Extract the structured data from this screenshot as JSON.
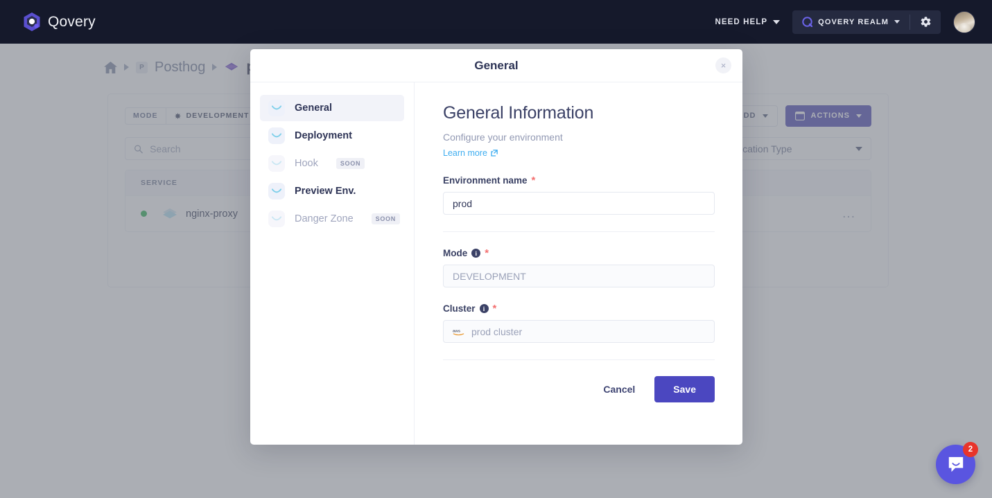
{
  "navbar": {
    "brand": "Qovery",
    "need_help": "NEED HELP",
    "realm": "QOVERY REALM",
    "icons": {
      "logo": "qovery-logo-icon",
      "chevron": "chevron-down-icon",
      "gear": "gear-icon",
      "avatar": "user-avatar"
    }
  },
  "breadcrumb": {
    "home": "home-icon",
    "org_badge": "P",
    "project": "Posthog",
    "environment": "p"
  },
  "page": {
    "mode_chip": {
      "label": "MODE",
      "value": "DEVELOPMENT"
    },
    "add_button": "ADD",
    "actions_button": "ACTIONS",
    "search_placeholder": "Search",
    "search_value": "",
    "type_filter": "Application Type",
    "table": {
      "columns": [
        "SERVICE"
      ],
      "rows": [
        {
          "status": "running",
          "name": "nginx-proxy",
          "menu": "..."
        }
      ]
    }
  },
  "modal": {
    "title": "General",
    "close": "×",
    "nav": [
      {
        "label": "General",
        "active": true,
        "muted": false,
        "badge": ""
      },
      {
        "label": "Deployment",
        "active": false,
        "muted": false,
        "badge": ""
      },
      {
        "label": "Hook",
        "active": false,
        "muted": true,
        "badge": "SOON"
      },
      {
        "label": "Preview Env.",
        "active": false,
        "muted": false,
        "badge": ""
      },
      {
        "label": "Danger Zone",
        "active": false,
        "muted": true,
        "badge": "SOON"
      }
    ],
    "heading": "General Information",
    "subheading": "Configure your environment",
    "learn_more": "Learn more",
    "fields": {
      "env_name": {
        "label": "Environment name",
        "required": "*",
        "value": "prod"
      },
      "mode": {
        "label": "Mode",
        "required": "*",
        "value": "DEVELOPMENT",
        "info": "i"
      },
      "cluster": {
        "label": "Cluster",
        "required": "*",
        "value": "prod cluster",
        "info": "i",
        "provider": "aws"
      }
    },
    "cancel": "Cancel",
    "save": "Save"
  },
  "intercom": {
    "badge": "2",
    "icon": "chat-bubble-icon"
  },
  "colors": {
    "navbar_bg": "#15192b",
    "brand_purple": "#5a4fcf",
    "accent_primary": "#4b47c0",
    "link_blue": "#3dadf0",
    "required_red": "#f37070",
    "status_green": "#22b14c",
    "badge_red": "#e8342a",
    "overlay": "rgba(120,124,134,0.62)"
  }
}
